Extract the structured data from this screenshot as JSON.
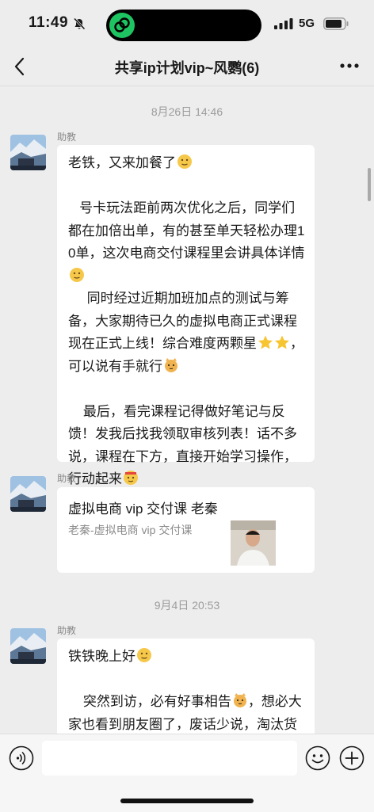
{
  "status_bar": {
    "time": "11:49",
    "network": "5G"
  },
  "header": {
    "title": "共享ip计划vip~风鹦(6)"
  },
  "chat": {
    "timestamp_1": "8月26日 14:46",
    "msg1": {
      "sender": "助教",
      "p1": "老铁，又来加餐了",
      "p2": "   号卡玩法距前两次优化之后，同学们都在加倍出单，有的甚至单天轻松办理10单，这次电商交付课程里会讲具体详情",
      "p3": "     同时经过近期加班加点的测试与筹备，大家期待已久的虚拟电商正式课程现在正式上线！综合难度两颗星",
      "p3b": "，可以说有手就行",
      "p4": "    最后，看完课程记得做好笔记与反馈！发我后找我领取审核列表！话不多说，课程在下方，直接开始学习操作，行动起来"
    },
    "msg2": {
      "sender": "助教",
      "card_title": "虚拟电商 vip 交付课 老秦",
      "card_subtitle": "老秦-虚拟电商 vip 交付课"
    },
    "timestamp_2": "9月4日 20:53",
    "msg3": {
      "sender": "助教",
      "p1": "铁铁晚上好",
      "p2a": "    突然到访，必有好事相告",
      "p2b": "，想必大家也看到朋友圈了，废话少说，淘汰货物实际系统，联盟平台，先"
    }
  },
  "colors": {
    "background": "#ededed",
    "bubble": "#ffffff",
    "accent": "#1fc462"
  },
  "icons": [
    "mute-icon",
    "signal-icon",
    "battery-icon",
    "back-icon",
    "more-icon",
    "voice-icon",
    "sticker-icon",
    "plus-icon"
  ]
}
